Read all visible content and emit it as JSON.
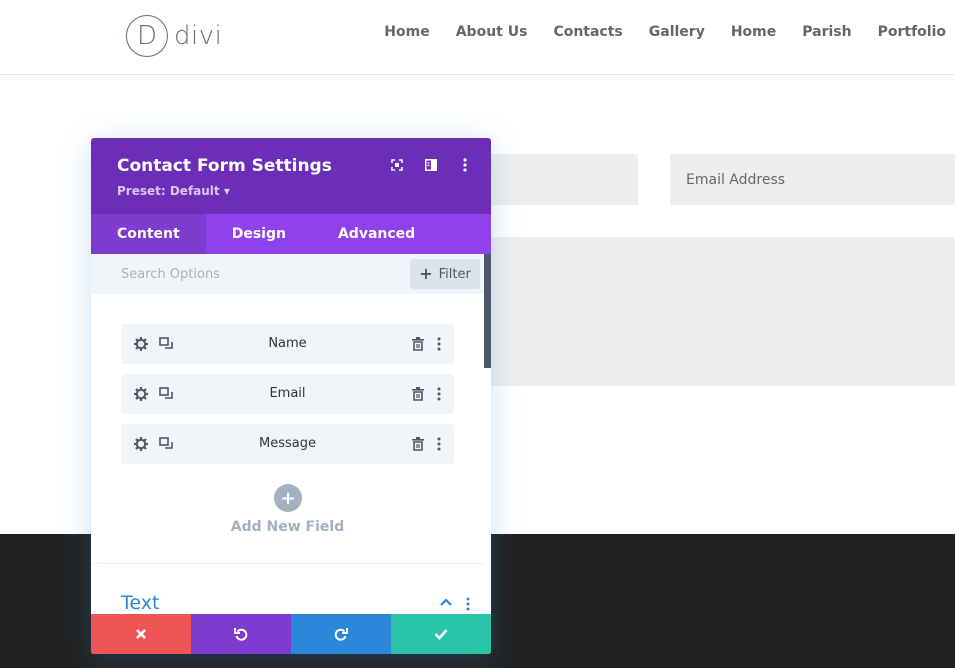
{
  "site": {
    "logo_letter": "D",
    "logo_text": "divi",
    "nav": [
      "Home",
      "About Us",
      "Contacts",
      "Gallery",
      "Home",
      "Parish",
      "Portfolio"
    ]
  },
  "page": {
    "email_placeholder": "Email Address"
  },
  "modal": {
    "title": "Contact Form Settings",
    "preset": "Preset: Default ▾",
    "tabs": [
      "Content",
      "Design",
      "Advanced"
    ],
    "active_tab": "Content",
    "search_placeholder": "Search Options",
    "filter_label": "Filter",
    "fields": [
      "Name",
      "Email",
      "Message"
    ],
    "add_field_label": "Add New Field",
    "section_title": "Text"
  },
  "colors": {
    "header_purple": "#6c2eb9",
    "tabs_purple": "#8f42ec",
    "accent_blue": "#2b87da",
    "cancel_red": "#ef5555",
    "save_green": "#29c4a9"
  }
}
